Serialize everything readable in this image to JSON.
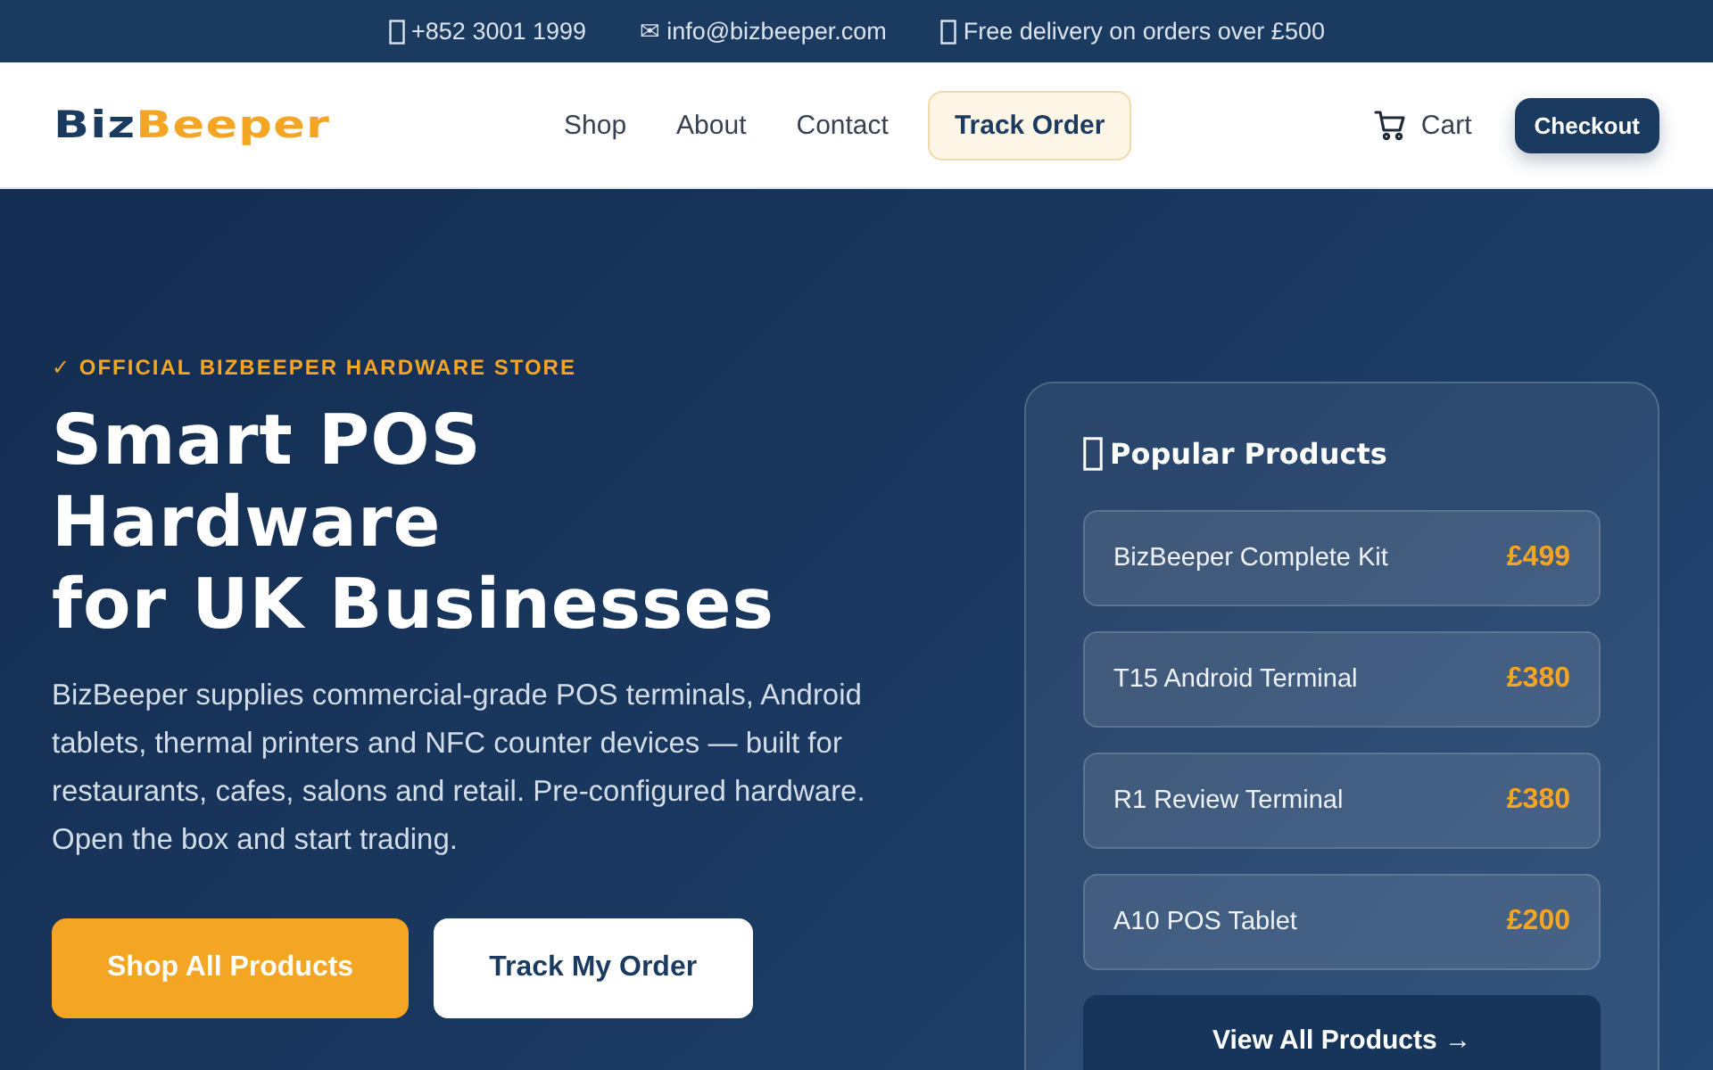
{
  "topbar": [
    {
      "kind": "box",
      "text": "+852 3001 1999"
    },
    {
      "kind": "mail",
      "text": "✉ info@bizbeeper.com"
    },
    {
      "kind": "box",
      "text": "Free delivery on orders over £500"
    }
  ],
  "header": {
    "logo": {
      "part_1": "Biz",
      "part_2": "Beeper"
    },
    "nav": [
      {
        "label": "Shop",
        "kind": "link"
      },
      {
        "label": "About",
        "kind": "link"
      },
      {
        "label": "Contact",
        "kind": "link"
      },
      {
        "label": "Track Order",
        "kind": "highlight"
      }
    ],
    "cart": "Cart",
    "checkout": "Checkout"
  },
  "hero": {
    "eyebrow": "✓ OFFICIAL BIZBEEPER HARDWARE STORE",
    "title_lines": [
      "Smart POS",
      "Hardware",
      "for UK Businesses"
    ],
    "text": "BizBeeper supplies commercial-grade POS terminals, Android tablets, thermal printers and NFC counter devices — built for restaurants, cafes, salons and retail. Pre-configured hardware. Open the box and start trading.",
    "buttons": [
      {
        "label": "Shop All Products",
        "kind": "primary"
      },
      {
        "label": "Track My Order",
        "kind": "secondary"
      }
    ]
  },
  "popular": {
    "title": "Popular Products",
    "items": [
      {
        "name": "BizBeeper Complete Kit",
        "price": "£499"
      },
      {
        "name": "T15 Android Terminal",
        "price": "£380"
      },
      {
        "name": "R1 Review Terminal",
        "price": "£380"
      },
      {
        "name": "A10 POS Tablet",
        "price": "£200"
      }
    ],
    "button": "View All Products →"
  }
}
